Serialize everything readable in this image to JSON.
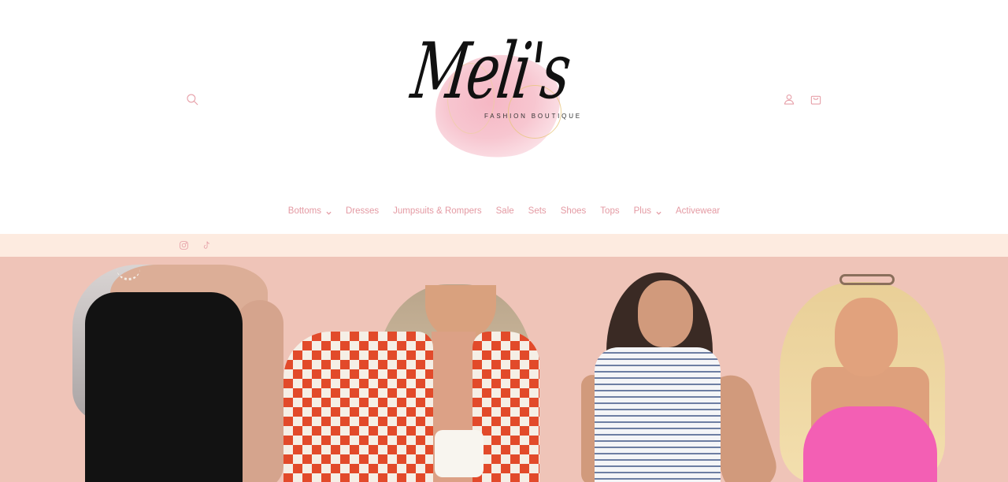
{
  "store": {
    "logo_script": "Meli's",
    "logo_subtitle": "FASHION BOUTIQUE"
  },
  "header": {
    "icons": [
      "search-icon",
      "account-icon",
      "cart-icon"
    ]
  },
  "nav": {
    "items": [
      {
        "label": "Bottoms",
        "has_dropdown": true
      },
      {
        "label": "Dresses",
        "has_dropdown": false
      },
      {
        "label": "Jumpsuits & Rompers",
        "has_dropdown": false
      },
      {
        "label": "Sale",
        "has_dropdown": false
      },
      {
        "label": "Sets",
        "has_dropdown": false
      },
      {
        "label": "Shoes",
        "has_dropdown": false
      },
      {
        "label": "Tops",
        "has_dropdown": false
      },
      {
        "label": "Plus",
        "has_dropdown": true
      },
      {
        "label": "Activewear",
        "has_dropdown": false
      }
    ]
  },
  "social": {
    "icons": [
      "instagram-icon",
      "tiktok-icon"
    ]
  },
  "colors": {
    "accent": "#e49aa3",
    "social_bar_bg": "#fdebe0",
    "hero_bg": "#efc4b8"
  }
}
